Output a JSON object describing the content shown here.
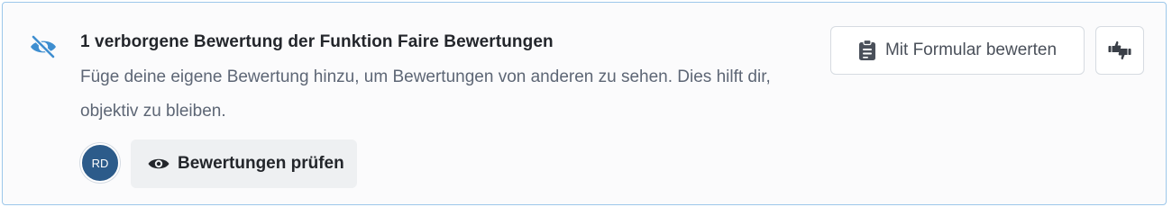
{
  "notice": {
    "title": "1 verborgene Bewertung der Funktion Faire Bewertungen",
    "description": "Füge deine eigene Bewertung hinzu, um Bewertungen von anderen zu sehen. Dies hilft dir, objektiv zu bleiben.",
    "icon": "eye-slash-icon",
    "accent_color": "#3e8ed0"
  },
  "reviewer": {
    "initials": "RD",
    "avatar_color": "#2c5b8a"
  },
  "actions": {
    "review_button_label": "Bewertungen prüfen",
    "review_button_icon": "eye-icon",
    "form_button_label": "Mit Formular bewerten",
    "form_button_icon": "clipboard-icon",
    "thumbs_button_icon": "thumbs-up-down-icon"
  }
}
